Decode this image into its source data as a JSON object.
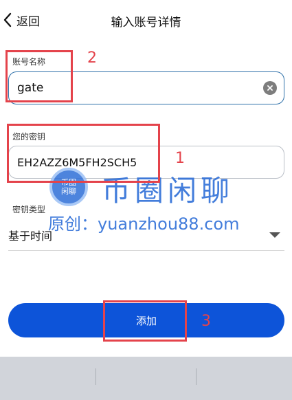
{
  "header": {
    "back_label": "返回",
    "title": "输入账号详情"
  },
  "account_name": {
    "label": "账号名称",
    "value": "gate"
  },
  "secret_key": {
    "label": "您的密钥",
    "value": "EH2AZZ6M5FH2SCH5"
  },
  "key_type": {
    "label": "密钥类型",
    "selected": "基于时间"
  },
  "add_button": {
    "label": "添加"
  },
  "annotations": {
    "one": "1",
    "two": "2",
    "three": "3",
    "color": "#e4434b"
  },
  "watermark": {
    "logo_line1": "币圈",
    "logo_line2": "闲聊",
    "title": "币圈闲聊",
    "subtitle": "原创：yuanzhou88.com"
  },
  "colors": {
    "accent": "#0d54d9",
    "focus_border": "#2c6fa8",
    "keyboard_bg": "#d1d4da"
  }
}
